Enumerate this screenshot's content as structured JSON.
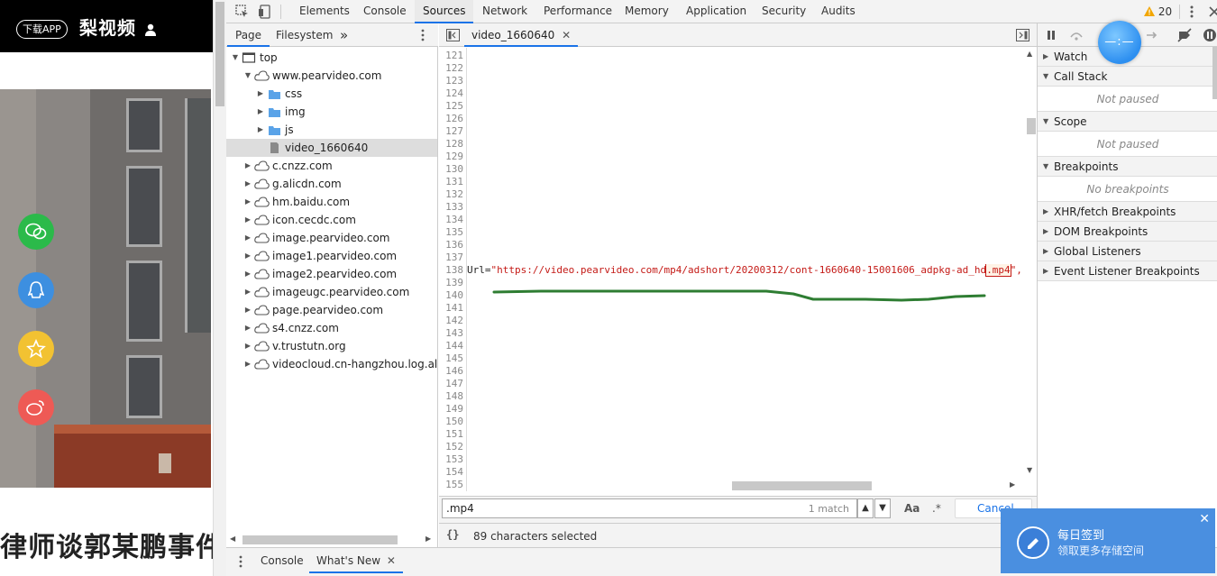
{
  "webpage": {
    "app_button": "下载APP",
    "logo": "梨视频",
    "article_title": "律师谈郭某鹏事件"
  },
  "devtools": {
    "main_tabs": [
      "Elements",
      "Console",
      "Sources",
      "Network",
      "Performance",
      "Memory",
      "Application",
      "Security",
      "Audits"
    ],
    "active_tab": "Sources",
    "warning_count": "20",
    "navigator": {
      "tabs": [
        "Page",
        "Filesystem"
      ],
      "more": "»",
      "tree": [
        {
          "label": "top",
          "level": 0,
          "icon": "frame-icon",
          "open": true
        },
        {
          "label": "www.pearvideo.com",
          "level": 1,
          "icon": "cloud-icon",
          "open": true
        },
        {
          "label": "css",
          "level": 2,
          "icon": "folder-icon",
          "open": false
        },
        {
          "label": "img",
          "level": 2,
          "icon": "folder-icon",
          "open": false
        },
        {
          "label": "js",
          "level": 2,
          "icon": "folder-icon",
          "open": false
        },
        {
          "label": "video_1660640",
          "level": 2,
          "icon": "file-icon",
          "selected": true
        },
        {
          "label": "c.cnzz.com",
          "level": 1,
          "icon": "cloud-icon",
          "open": false
        },
        {
          "label": "g.alicdn.com",
          "level": 1,
          "icon": "cloud-icon",
          "open": false
        },
        {
          "label": "hm.baidu.com",
          "level": 1,
          "icon": "cloud-icon",
          "open": false
        },
        {
          "label": "icon.cecdc.com",
          "level": 1,
          "icon": "cloud-icon",
          "open": false
        },
        {
          "label": "image.pearvideo.com",
          "level": 1,
          "icon": "cloud-icon",
          "open": false
        },
        {
          "label": "image1.pearvideo.com",
          "level": 1,
          "icon": "cloud-icon",
          "open": false
        },
        {
          "label": "image2.pearvideo.com",
          "level": 1,
          "icon": "cloud-icon",
          "open": false
        },
        {
          "label": "imageugc.pearvideo.com",
          "level": 1,
          "icon": "cloud-icon",
          "open": false
        },
        {
          "label": "page.pearvideo.com",
          "level": 1,
          "icon": "cloud-icon",
          "open": false
        },
        {
          "label": "s4.cnzz.com",
          "level": 1,
          "icon": "cloud-icon",
          "open": false
        },
        {
          "label": "v.trustutn.org",
          "level": 1,
          "icon": "cloud-icon",
          "open": false
        },
        {
          "label": "videocloud.cn-hangzhou.log.aliyun",
          "level": 1,
          "icon": "cloud-icon",
          "open": false
        }
      ]
    },
    "editor": {
      "file_tab": "video_1660640",
      "line_start": 121,
      "line_end": 155,
      "code_line_number": 138,
      "code_prefix": "Url=",
      "code_string_before": "\"https://video.pearvideo.com/mp4/adshort/20200312/cont-1660640-15001606_adpkg-ad_hd",
      "code_match": ".mp4",
      "code_string_after": "\",v"
    },
    "search": {
      "query": ".mp4",
      "match_count": "1 match",
      "match_case": "Aa",
      "regex": ".*",
      "cancel": "Cancel"
    },
    "status": {
      "pretty_print": "{}",
      "selection": "89 characters selected"
    },
    "debugger": {
      "panes": [
        {
          "title": "Watch"
        },
        {
          "title": "Call Stack",
          "body": "Not paused"
        },
        {
          "title": "Scope",
          "body": "Not paused"
        },
        {
          "title": "Breakpoints",
          "body": "No breakpoints"
        },
        {
          "title": "XHR/fetch Breakpoints"
        },
        {
          "title": "DOM Breakpoints"
        },
        {
          "title": "Global Listeners"
        },
        {
          "title": "Event Listener Breakpoints"
        }
      ]
    },
    "drawer_tabs": [
      "Console",
      "What's New"
    ]
  },
  "overlay": {
    "toast_title": "每日签到",
    "toast_sub": "领取更多存储空间",
    "toast_close": "✕"
  },
  "colors": {
    "accent": "#1a73e8",
    "string": "#c41a16",
    "annotation": "#2e7d32",
    "toast": "#4a8fe0"
  }
}
